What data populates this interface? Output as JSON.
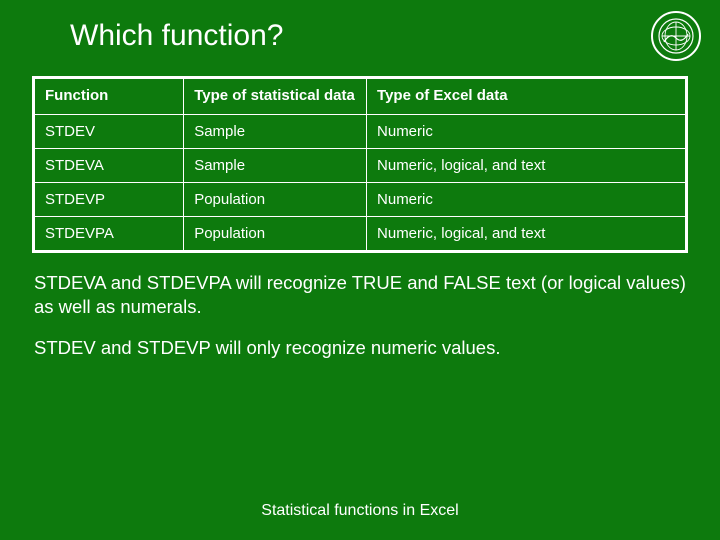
{
  "title": "Which function?",
  "logo_name": "institute-seal",
  "table": {
    "headers": [
      "Function",
      "Type of statistical data",
      "Type of Excel data"
    ],
    "rows": [
      [
        "STDEV",
        "Sample",
        "Numeric"
      ],
      [
        "STDEVA",
        "Sample",
        "Numeric, logical, and text"
      ],
      [
        "STDEVP",
        "Population",
        "Numeric"
      ],
      [
        "STDEVPA",
        "Population",
        "Numeric, logical, and text"
      ]
    ]
  },
  "notes": [
    "STDEVA and STDEVPA will recognize TRUE and FALSE text (or logical values) as well as numerals.",
    "STDEV and STDEVP will only recognize numeric values."
  ],
  "footer": "Statistical functions in Excel"
}
